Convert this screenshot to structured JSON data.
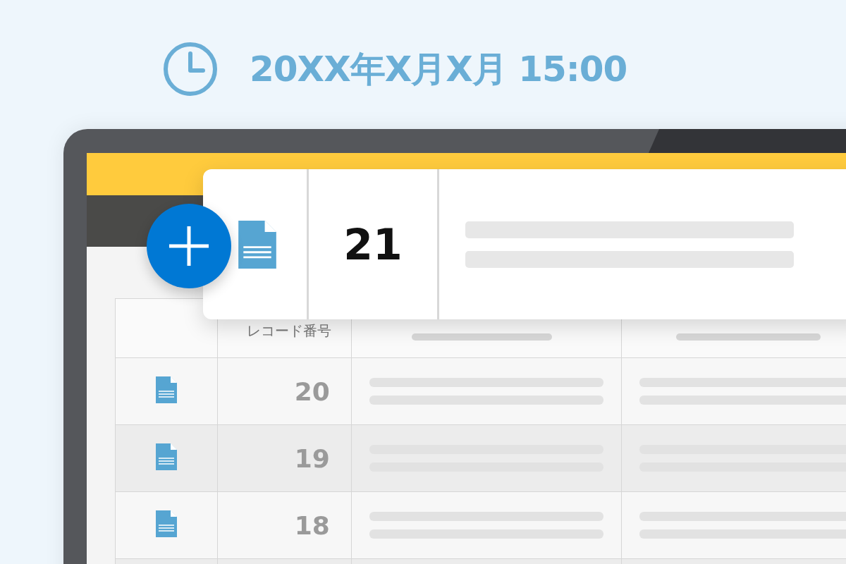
{
  "datetime": "20XX年X月X月 15:00",
  "new_record": {
    "number": "21"
  },
  "table": {
    "columns": [
      {
        "label": "レコード番号"
      }
    ],
    "rows": [
      {
        "number": "20"
      },
      {
        "number": "19"
      },
      {
        "number": "18"
      }
    ]
  }
}
